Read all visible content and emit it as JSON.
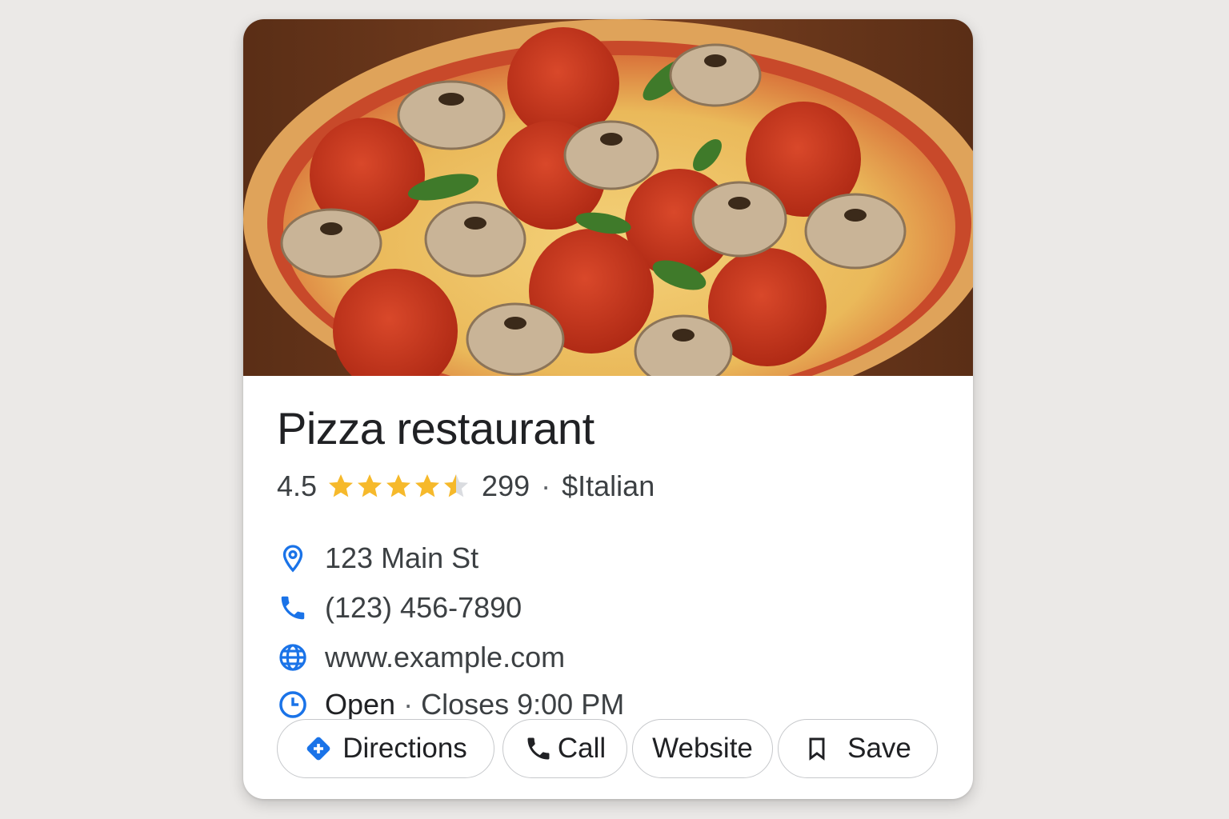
{
  "place": {
    "name": "Pizza restaurant",
    "photo_icon": "pizza-photo"
  },
  "rating": {
    "value": "4.5",
    "stars": 4.5,
    "reviews_count": "299",
    "separator": "·",
    "price_category": "$Italian",
    "star_color": "#f6b92b"
  },
  "info": {
    "address": {
      "icon": "location-pin-icon",
      "text": "123 Main St"
    },
    "phone": {
      "icon": "phone-icon",
      "text": "(123) 456-7890"
    },
    "website": {
      "icon": "globe-icon",
      "text": "www.example.com"
    },
    "hours": {
      "icon": "clock-icon",
      "status": "Open",
      "separator": "·",
      "detail": "Closes 9:00 PM"
    },
    "icon_color": "#1a73e8"
  },
  "actions": {
    "directions": {
      "label": "Directions",
      "icon": "directions-icon"
    },
    "call": {
      "label": "Call",
      "icon": "phone-icon"
    },
    "website": {
      "label": "Website"
    },
    "save": {
      "label": "Save",
      "icon": "bookmark-icon"
    }
  }
}
